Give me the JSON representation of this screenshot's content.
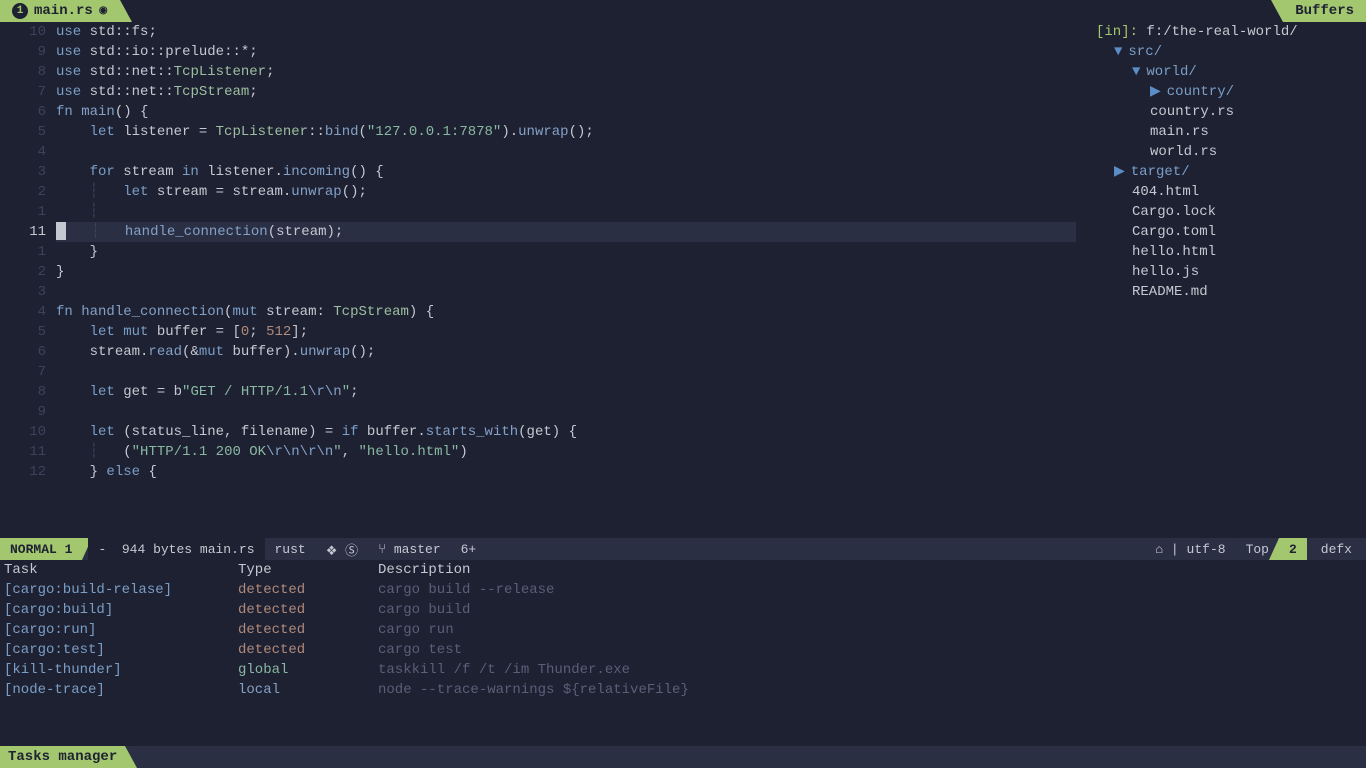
{
  "tabs": {
    "left_num": "1",
    "left_name": "main.rs",
    "left_dot": "◉",
    "right": "Buffers"
  },
  "gutter": [
    "10",
    "9",
    "8",
    "7",
    "6",
    "5",
    "4",
    "3",
    "2",
    "1",
    "11",
    "1",
    "2",
    "3",
    "4",
    "5",
    "6",
    "7",
    "8",
    "9",
    "10",
    "11",
    "12"
  ],
  "gutter_current_index": 10,
  "code": [
    [
      {
        "c": "kw",
        "t": "use "
      },
      {
        "c": "ident",
        "t": "std"
      },
      {
        "c": "op",
        "t": "::"
      },
      {
        "c": "ident",
        "t": "fs"
      },
      {
        "c": "punct",
        "t": ";"
      }
    ],
    [
      {
        "c": "kw",
        "t": "use "
      },
      {
        "c": "ident",
        "t": "std"
      },
      {
        "c": "op",
        "t": "::"
      },
      {
        "c": "ident",
        "t": "io"
      },
      {
        "c": "op",
        "t": "::"
      },
      {
        "c": "ident",
        "t": "prelude"
      },
      {
        "c": "op",
        "t": "::*"
      },
      {
        "c": "punct",
        "t": ";"
      }
    ],
    [
      {
        "c": "kw",
        "t": "use "
      },
      {
        "c": "ident",
        "t": "std"
      },
      {
        "c": "op",
        "t": "::"
      },
      {
        "c": "ident",
        "t": "net"
      },
      {
        "c": "op",
        "t": "::"
      },
      {
        "c": "type",
        "t": "TcpListener"
      },
      {
        "c": "punct",
        "t": ";"
      }
    ],
    [
      {
        "c": "kw",
        "t": "use "
      },
      {
        "c": "ident",
        "t": "std"
      },
      {
        "c": "op",
        "t": "::"
      },
      {
        "c": "ident",
        "t": "net"
      },
      {
        "c": "op",
        "t": "::"
      },
      {
        "c": "type",
        "t": "TcpStream"
      },
      {
        "c": "punct",
        "t": ";"
      }
    ],
    [
      {
        "c": "kw",
        "t": "fn "
      },
      {
        "c": "fn",
        "t": "main"
      },
      {
        "c": "punct",
        "t": "() {"
      }
    ],
    [
      {
        "c": "op",
        "t": "    "
      },
      {
        "c": "kw",
        "t": "let "
      },
      {
        "c": "ident",
        "t": "listener "
      },
      {
        "c": "op",
        "t": "= "
      },
      {
        "c": "type",
        "t": "TcpListener"
      },
      {
        "c": "op",
        "t": "::"
      },
      {
        "c": "fn",
        "t": "bind"
      },
      {
        "c": "punct",
        "t": "("
      },
      {
        "c": "str",
        "t": "\"127.0.0.1:7878\""
      },
      {
        "c": "punct",
        "t": ")."
      },
      {
        "c": "fn",
        "t": "unwrap"
      },
      {
        "c": "punct",
        "t": "();"
      }
    ],
    [
      {
        "c": "op",
        "t": " "
      }
    ],
    [
      {
        "c": "op",
        "t": "    "
      },
      {
        "c": "kw",
        "t": "for "
      },
      {
        "c": "ident",
        "t": "stream "
      },
      {
        "c": "kw",
        "t": "in "
      },
      {
        "c": "ident",
        "t": "listener."
      },
      {
        "c": "fn",
        "t": "incoming"
      },
      {
        "c": "punct",
        "t": "() {"
      }
    ],
    [
      {
        "c": "op",
        "t": "    "
      },
      {
        "c": "indent-guide",
        "t": "┆   "
      },
      {
        "c": "kw",
        "t": "let "
      },
      {
        "c": "ident",
        "t": "stream "
      },
      {
        "c": "op",
        "t": "= "
      },
      {
        "c": "ident",
        "t": "stream."
      },
      {
        "c": "fn",
        "t": "unwrap"
      },
      {
        "c": "punct",
        "t": "();"
      }
    ],
    [
      {
        "c": "indent-guide",
        "t": "    ┆"
      }
    ],
    [
      {
        "c": "cursor",
        "t": ""
      },
      {
        "c": "op",
        "t": "   "
      },
      {
        "c": "indent-guide",
        "t": "┆   "
      },
      {
        "c": "fn",
        "t": "handle_connection"
      },
      {
        "c": "punct",
        "t": "(stream);"
      }
    ],
    [
      {
        "c": "op",
        "t": "    "
      },
      {
        "c": "punct",
        "t": "}"
      }
    ],
    [
      {
        "c": "punct",
        "t": "}"
      }
    ],
    [
      {
        "c": "op",
        "t": " "
      }
    ],
    [
      {
        "c": "kw",
        "t": "fn "
      },
      {
        "c": "fn",
        "t": "handle_connection"
      },
      {
        "c": "punct",
        "t": "("
      },
      {
        "c": "kw",
        "t": "mut "
      },
      {
        "c": "ident",
        "t": "stream: "
      },
      {
        "c": "type",
        "t": "TcpStream"
      },
      {
        "c": "punct",
        "t": ") {"
      }
    ],
    [
      {
        "c": "op",
        "t": "    "
      },
      {
        "c": "kw",
        "t": "let mut "
      },
      {
        "c": "ident",
        "t": "buffer "
      },
      {
        "c": "op",
        "t": "= "
      },
      {
        "c": "punct",
        "t": "["
      },
      {
        "c": "num",
        "t": "0"
      },
      {
        "c": "punct",
        "t": "; "
      },
      {
        "c": "num",
        "t": "512"
      },
      {
        "c": "punct",
        "t": "];"
      }
    ],
    [
      {
        "c": "op",
        "t": "    "
      },
      {
        "c": "ident",
        "t": "stream."
      },
      {
        "c": "fn",
        "t": "read"
      },
      {
        "c": "punct",
        "t": "("
      },
      {
        "c": "op",
        "t": "&"
      },
      {
        "c": "kw",
        "t": "mut "
      },
      {
        "c": "ident",
        "t": "buffer"
      },
      {
        "c": "punct",
        "t": ")."
      },
      {
        "c": "fn",
        "t": "unwrap"
      },
      {
        "c": "punct",
        "t": "();"
      }
    ],
    [
      {
        "c": "op",
        "t": " "
      }
    ],
    [
      {
        "c": "op",
        "t": "    "
      },
      {
        "c": "kw",
        "t": "let "
      },
      {
        "c": "ident",
        "t": "get "
      },
      {
        "c": "op",
        "t": "= "
      },
      {
        "c": "ident",
        "t": "b"
      },
      {
        "c": "str",
        "t": "\"GET / HTTP/1.1"
      },
      {
        "c": "esc",
        "t": "\\r\\n"
      },
      {
        "c": "str",
        "t": "\""
      },
      {
        "c": "punct",
        "t": ";"
      }
    ],
    [
      {
        "c": "op",
        "t": " "
      }
    ],
    [
      {
        "c": "op",
        "t": "    "
      },
      {
        "c": "kw",
        "t": "let "
      },
      {
        "c": "punct",
        "t": "("
      },
      {
        "c": "ident",
        "t": "status_line"
      },
      {
        "c": "punct",
        "t": ", "
      },
      {
        "c": "ident",
        "t": "filename"
      },
      {
        "c": "punct",
        "t": ") "
      },
      {
        "c": "op",
        "t": "= "
      },
      {
        "c": "kw",
        "t": "if "
      },
      {
        "c": "ident",
        "t": "buffer."
      },
      {
        "c": "fn",
        "t": "starts_with"
      },
      {
        "c": "punct",
        "t": "(get) {"
      }
    ],
    [
      {
        "c": "op",
        "t": "    "
      },
      {
        "c": "indent-guide",
        "t": "┆   "
      },
      {
        "c": "punct",
        "t": "("
      },
      {
        "c": "str",
        "t": "\"HTTP/1.1 200 OK"
      },
      {
        "c": "esc",
        "t": "\\r\\n\\r\\n"
      },
      {
        "c": "str",
        "t": "\""
      },
      {
        "c": "punct",
        "t": ", "
      },
      {
        "c": "str",
        "t": "\"hello.html\""
      },
      {
        "c": "punct",
        "t": ")"
      }
    ],
    [
      {
        "c": "op",
        "t": "    "
      },
      {
        "c": "punct",
        "t": "} "
      },
      {
        "c": "kw",
        "t": "else "
      },
      {
        "c": "punct",
        "t": "{"
      }
    ]
  ],
  "hl_line_index": 10,
  "tree": {
    "header_in": "[in]: ",
    "header_path": "f:/the-real-world/",
    "items": [
      {
        "indent": 1,
        "arrow": "▼",
        "type": "dir",
        "name": "src/"
      },
      {
        "indent": 2,
        "arrow": "▼",
        "type": "dir",
        "name": "world/"
      },
      {
        "indent": 3,
        "arrow": "▶",
        "type": "dir",
        "name": "country/"
      },
      {
        "indent": 3,
        "arrow": "",
        "type": "file",
        "name": "country.rs"
      },
      {
        "indent": 3,
        "arrow": "",
        "type": "file",
        "name": "main.rs"
      },
      {
        "indent": 3,
        "arrow": "",
        "type": "file",
        "name": "world.rs"
      },
      {
        "indent": 1,
        "arrow": "▶",
        "type": "dir",
        "name": "target/"
      },
      {
        "indent": 2,
        "arrow": "",
        "type": "file",
        "name": "404.html"
      },
      {
        "indent": 2,
        "arrow": "",
        "type": "file",
        "name": "Cargo.lock"
      },
      {
        "indent": 2,
        "arrow": "",
        "type": "file",
        "name": "Cargo.toml"
      },
      {
        "indent": 2,
        "arrow": "",
        "type": "file",
        "name": "hello.html"
      },
      {
        "indent": 2,
        "arrow": "",
        "type": "file",
        "name": "hello.js"
      },
      {
        "indent": 2,
        "arrow": "",
        "type": "file",
        "name": "README.md"
      }
    ]
  },
  "status": {
    "mode": "NORMAL",
    "mode_num": "1",
    "dash": "-",
    "bytes": "944 bytes",
    "file": "main.rs",
    "lang": "rust",
    "icons": "❖ Ⓢ",
    "branch_icon": "⑂",
    "branch": "master",
    "ahead": "6+",
    "os_icon": "⌂",
    "pipe": "|",
    "enc": "utf-8",
    "pos": "Top",
    "win2": "2",
    "defx": "defx"
  },
  "tasks": {
    "headers": [
      "Task",
      "Type",
      "Description"
    ],
    "rows": [
      {
        "name": "[cargo:build-relase]",
        "type": "detected",
        "type_cls": "task-type",
        "desc": "cargo build --release"
      },
      {
        "name": "[cargo:build]",
        "type": "detected",
        "type_cls": "task-type",
        "desc": "cargo build"
      },
      {
        "name": "[cargo:run]",
        "type": "detected",
        "type_cls": "task-type",
        "desc": "cargo run"
      },
      {
        "name": "[cargo:test]",
        "type": "detected",
        "type_cls": "task-type",
        "desc": "cargo test"
      },
      {
        "name": "[kill-thunder]",
        "type": "global",
        "type_cls": "task-type-g",
        "desc": "taskkill /f /t /im Thunder.exe"
      },
      {
        "name": "[node-trace]",
        "type": "local",
        "type_cls": "task-type-l",
        "desc": "node --trace-warnings ${relativeFile}"
      }
    ]
  },
  "bottom": "Tasks manager"
}
